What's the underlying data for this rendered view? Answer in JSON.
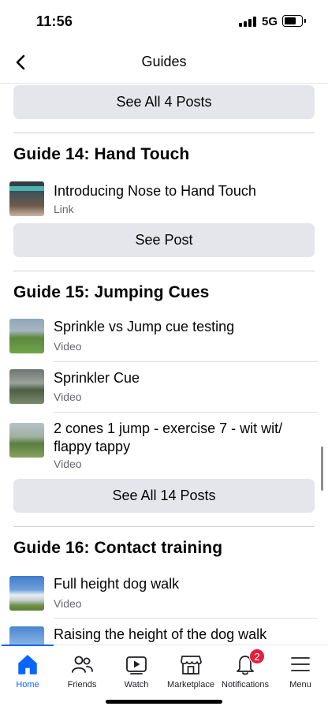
{
  "status_bar": {
    "time": "11:56",
    "network": "5G"
  },
  "header": {
    "title": "Guides"
  },
  "sections": {
    "see_all_4": "See All 4 Posts",
    "guide14": {
      "title": "Guide 14: Hand Touch",
      "posts": [
        {
          "title": "Introducing Nose to Hand Touch",
          "type": "Link"
        }
      ],
      "button": "See Post"
    },
    "guide15": {
      "title": "Guide 15: Jumping Cues",
      "posts": [
        {
          "title": "Sprinkle vs Jump cue testing",
          "type": "Video"
        },
        {
          "title": "Sprinkler Cue",
          "type": "Video"
        },
        {
          "title": "2 cones 1 jump - exercise 7 - wit wit/ flappy tappy",
          "type": "Video"
        }
      ],
      "button": "See All 14 Posts"
    },
    "guide16": {
      "title": "Guide 16: Contact training",
      "posts": [
        {
          "title": "Full height dog walk",
          "type": "Video"
        },
        {
          "title": "Raising the height of the dog walk",
          "type": ""
        }
      ]
    }
  },
  "tab_bar": {
    "tabs": [
      {
        "label": "Home",
        "icon": "home-icon"
      },
      {
        "label": "Friends",
        "icon": "friends-icon"
      },
      {
        "label": "Watch",
        "icon": "watch-icon"
      },
      {
        "label": "Marketplace",
        "icon": "marketplace-icon"
      },
      {
        "label": "Notifications",
        "icon": "bell-icon",
        "badge": "2"
      },
      {
        "label": "Menu",
        "icon": "menu-icon"
      }
    ],
    "active": "Home"
  },
  "colors": {
    "accent": "#0866ff",
    "badge": "#e41e3f",
    "button_bg": "#e4e6eb",
    "secondary_text": "#65676b"
  }
}
